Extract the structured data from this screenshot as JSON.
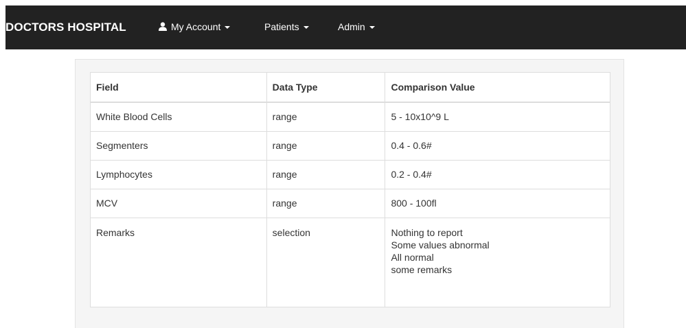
{
  "navbar": {
    "brand": "DOCTORS HOSPITAL",
    "menus": [
      {
        "label": "My Account",
        "icon": "user-icon"
      },
      {
        "label": "Patients"
      },
      {
        "label": "Admin"
      }
    ]
  },
  "table": {
    "headers": [
      "Field",
      "Data Type",
      "Comparison Value"
    ],
    "rows": [
      {
        "field": "White Blood Cells",
        "type": "range",
        "value": "5 - 10x10^9 L"
      },
      {
        "field": "Segmenters",
        "type": "range",
        "value": "0.4 - 0.6#"
      },
      {
        "field": "Lymphocytes",
        "type": "range",
        "value": "0.2 - 0.4#"
      },
      {
        "field": "MCV",
        "type": "range",
        "value": "800 - 100fl"
      },
      {
        "field": "Remarks",
        "type": "selection",
        "options": [
          "Nothing to report",
          "Some values abnormal",
          "All normal",
          "some remarks"
        ]
      }
    ]
  },
  "colors": {
    "navbar_bg": "#222222",
    "panel_bg": "#f5f5f5",
    "border": "#dddddd"
  }
}
